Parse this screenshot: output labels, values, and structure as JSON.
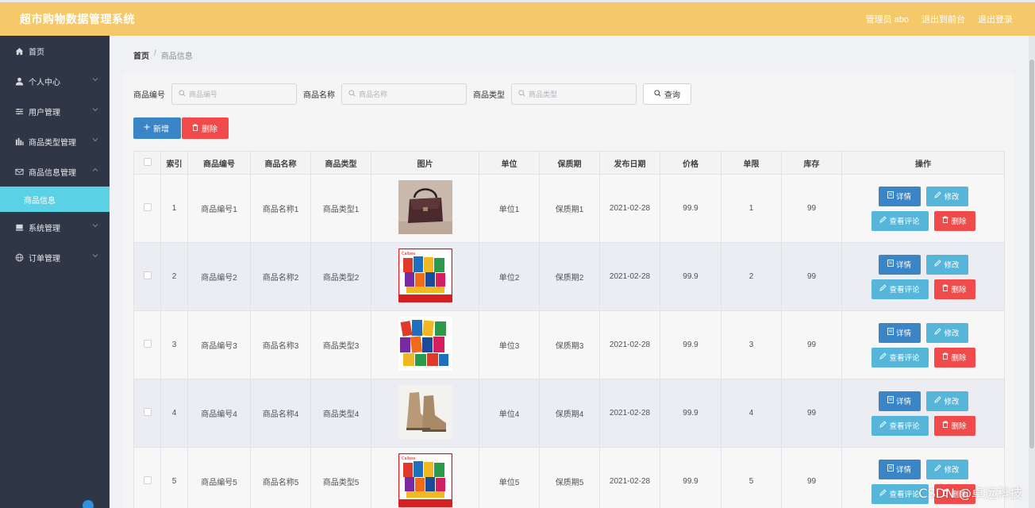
{
  "app": {
    "title": "超市购物数据管理系统"
  },
  "header": {
    "admin": "管理员 abo",
    "to_console": "退出到前台",
    "logout": "退出登录"
  },
  "sidebar": {
    "items": [
      {
        "label": "首页",
        "icon": "home-icon"
      },
      {
        "label": "个人中心",
        "icon": "user-icon"
      },
      {
        "label": "用户管理",
        "icon": "sliders-icon"
      },
      {
        "label": "商品类型管理",
        "icon": "bars-icon"
      },
      {
        "label": "商品信息管理",
        "icon": "mail-icon"
      },
      {
        "label": "系统管理",
        "icon": "drive-icon"
      },
      {
        "label": "订单管理",
        "icon": "globe-icon"
      }
    ],
    "active_sub": "商品信息"
  },
  "breadcrumb": {
    "home": "首页",
    "sep": "/",
    "current": "商品信息"
  },
  "search": {
    "code_label": "商品编号",
    "code_placeholder": "商品编号",
    "name_label": "商品名称",
    "name_placeholder": "商品名称",
    "type_label": "商品类型",
    "type_placeholder": "商品类型",
    "query": "查询"
  },
  "toolbar": {
    "add": "新增",
    "delete": "删除"
  },
  "table": {
    "headers": [
      "索引",
      "商品编号",
      "商品名称",
      "商品类型",
      "图片",
      "单位",
      "保质期",
      "发布日期",
      "价格",
      "单限",
      "库存",
      "操作"
    ],
    "ops": {
      "detail": "详情",
      "edit": "修改",
      "comment": "查看评论",
      "delete": "删除"
    },
    "rows": [
      {
        "index": "1",
        "code": "商品编号1",
        "name": "商品名称1",
        "type": "商品类型1",
        "image": "handbag",
        "unit": "单位1",
        "shelf": "保质期1",
        "date": "2021-02-28",
        "price": "99.9",
        "limit": "1",
        "stock": "99"
      },
      {
        "index": "2",
        "code": "商品编号2",
        "name": "商品名称2",
        "type": "商品类型2",
        "image": "snacks-box",
        "unit": "单位2",
        "shelf": "保质期2",
        "date": "2021-02-28",
        "price": "99.9",
        "limit": "2",
        "stock": "99"
      },
      {
        "index": "3",
        "code": "商品编号3",
        "name": "商品名称3",
        "type": "商品类型3",
        "image": "snacks-pile",
        "unit": "单位3",
        "shelf": "保质期3",
        "date": "2021-02-28",
        "price": "99.9",
        "limit": "3",
        "stock": "99"
      },
      {
        "index": "4",
        "code": "商品编号4",
        "name": "商品名称4",
        "type": "商品类型4",
        "image": "boots",
        "unit": "单位4",
        "shelf": "保质期4",
        "date": "2021-02-28",
        "price": "99.9",
        "limit": "4",
        "stock": "99"
      },
      {
        "index": "5",
        "code": "商品编号5",
        "name": "商品名称5",
        "type": "商品类型5",
        "image": "snacks-box",
        "unit": "单位5",
        "shelf": "保质期5",
        "date": "2021-02-28",
        "price": "99.9",
        "limit": "5",
        "stock": "99"
      }
    ]
  },
  "watermark": "CSDN @卓远科技",
  "colors": {
    "header": "#f5c96a",
    "sidebar": "#2f3746",
    "active_sub": "#5bd1e6",
    "primary": "#3a85c6",
    "info": "#56b6d9",
    "danger": "#f04a4a"
  }
}
